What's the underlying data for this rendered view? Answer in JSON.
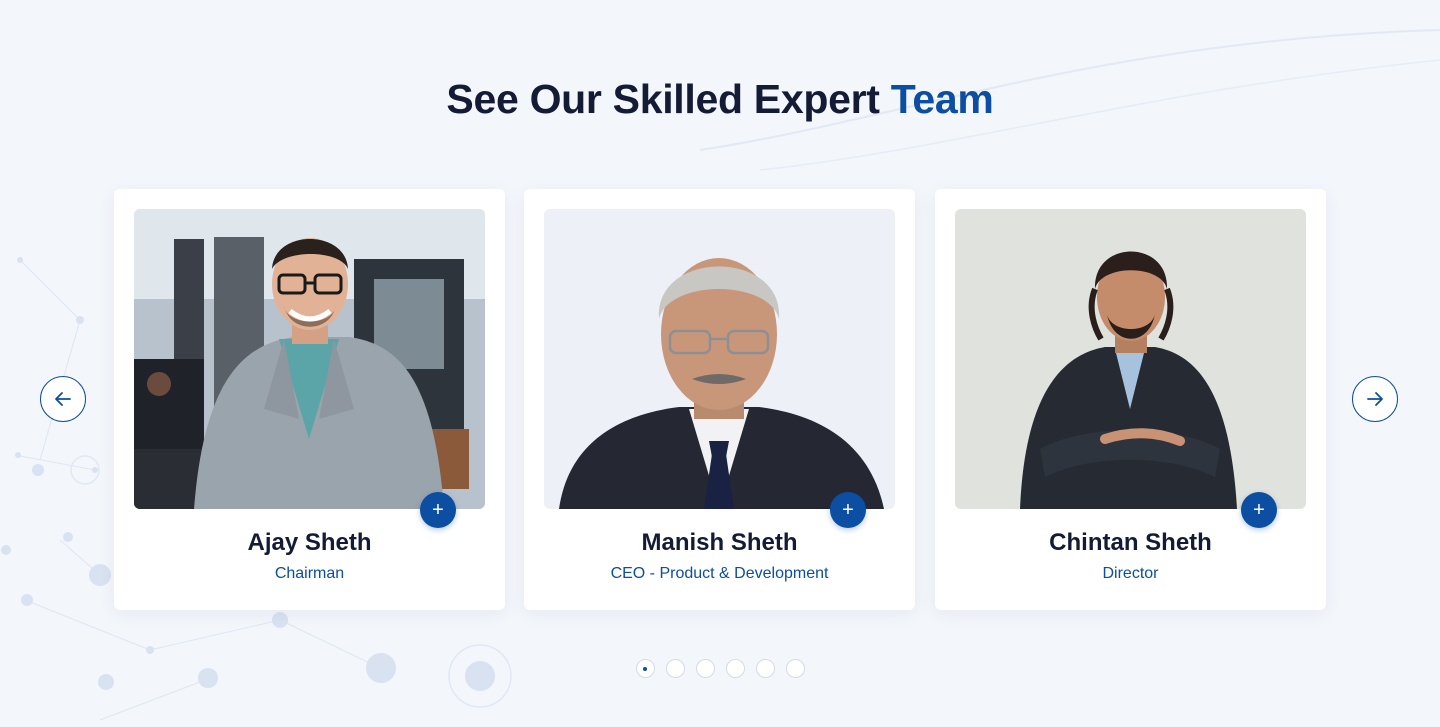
{
  "section": {
    "title_main": "See Our Skilled Expert ",
    "title_accent": "Team"
  },
  "team": [
    {
      "name": "Ajay Sheth",
      "role": "Chairman"
    },
    {
      "name": "Manish Sheth",
      "role": "CEO - Product & Development"
    },
    {
      "name": "Chintan Sheth",
      "role": "Director"
    }
  ],
  "controls": {
    "plus_icon": "+",
    "prev_icon": "arrow-left-icon",
    "next_icon": "arrow-right-icon"
  },
  "pagination": {
    "count": 6,
    "active_index": 0
  },
  "colors": {
    "accent": "#0b4ea2",
    "heading": "#141b34",
    "background": "#f3f6fb"
  }
}
